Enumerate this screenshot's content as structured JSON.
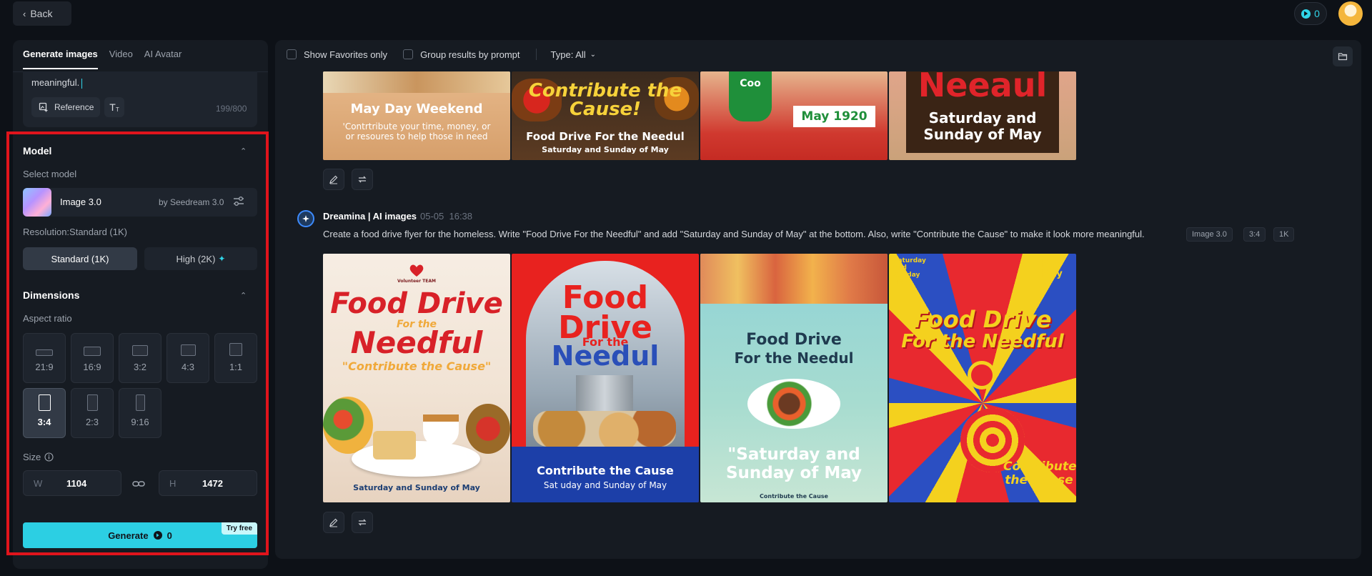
{
  "topbar": {
    "back_label": "Back",
    "credits": "0"
  },
  "left_panel": {
    "tabs": [
      {
        "label": "Generate images",
        "active": true
      },
      {
        "label": "Video",
        "active": false
      },
      {
        "label": "AI Avatar",
        "active": false
      }
    ],
    "prompt_tail": "meaningful.",
    "reference_label": "Reference",
    "text_tool_label": "T",
    "char_count": "199/800",
    "model_section": {
      "title": "Model",
      "select_label": "Select model",
      "model_name": "Image 3.0",
      "model_by": "by Seedream 3.0",
      "resolution_label": "Resolution:Standard (1K)",
      "res_standard": "Standard (1K)",
      "res_high": "High (2K)"
    },
    "dimensions_section": {
      "title": "Dimensions",
      "aspect_label": "Aspect ratio",
      "ratios": [
        "21:9",
        "16:9",
        "3:2",
        "4:3",
        "1:1",
        "3:4",
        "2:3",
        "9:16"
      ],
      "selected_ratio": "3:4",
      "size_label": "Size",
      "width_letter": "W",
      "width": "1104",
      "height_letter": "H",
      "height": "1472"
    },
    "generate_label": "Generate",
    "generate_cost": "0",
    "try_free": "Try free"
  },
  "filters": {
    "favorites_label": "Show Favorites only",
    "group_label": "Group results by prompt",
    "type_label": "Type: All"
  },
  "previous_results": {
    "images": [
      {
        "headline": "May Day Weekend",
        "body": "'Contrtribute your time, money, or or resoures to help those in need"
      },
      {
        "headline": "Contribute the Cause!",
        "line2": "Food Drive For the Needul",
        "line3": "Saturday and Sunday of May"
      },
      {
        "shirt": "Coo",
        "sign": "May 1920"
      },
      {
        "headline": "Neeaul",
        "line2": "Saturday and",
        "line3": "Sunday of May"
      }
    ]
  },
  "message": {
    "author": "Dreamina | AI images",
    "date": "05-05",
    "time": "16:38",
    "prompt": "Create a food drive flyer for the homeless. Write \"Food Drive For the Needful\" and add \"Saturday and Sunday of May\" at the bottom. Also, write \"Contribute the Cause\" to make it look more meaningful.",
    "tags": [
      "Image 3.0",
      "3:4",
      "1K"
    ],
    "images": [
      {
        "org": "Volunteer TEAM",
        "line1": "Food Drive",
        "line2": "For the",
        "line3": "Needful",
        "line4": "\"Contribute the Cause\"",
        "footer": "Saturday and Sunday of May"
      },
      {
        "line1": "Food",
        "line2": "Drive",
        "line3": "For the",
        "line4": "Needul",
        "footer1": "Contribute the Cause",
        "footer2": "Sat uday and Sunday of May"
      },
      {
        "line1": "Food Drive",
        "line2": "For the Needul",
        "line3": "\"Saturday and",
        "line4": "Sunday of May",
        "footer": "Contribute the Cause"
      },
      {
        "corner_left": "Saturday and Sunday May",
        "corner_right": "May May",
        "line1": "Food Drive",
        "line2": "For the Needful",
        "footer1": "Contribute",
        "footer2": "the Cause"
      }
    ]
  },
  "colors": {
    "accent": "#2ccfe3",
    "highlight": "#e0141c",
    "panel": "#161b22",
    "background": "#0d1117"
  }
}
